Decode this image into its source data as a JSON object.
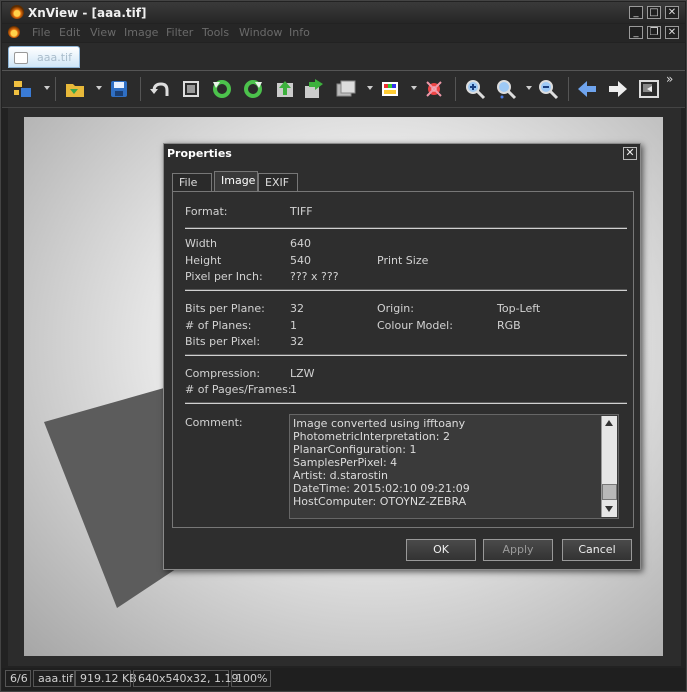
{
  "window": {
    "title": "XnView - [aaa.tif]",
    "buttons": {
      "minimize": "_",
      "maximize": "□",
      "close": "✕"
    },
    "child_buttons": {
      "minimize": "_",
      "restore": "❐",
      "close": "✕"
    }
  },
  "menu": [
    "File",
    "Edit",
    "View",
    "Image",
    "Filter",
    "Tools",
    "Window",
    "Info"
  ],
  "document_tab": {
    "label": "aaa.tif"
  },
  "toolbar": {
    "overflow": "»"
  },
  "dialog": {
    "title": "Properties",
    "close": "✕",
    "tabs": [
      "File",
      "Image",
      "EXIF"
    ],
    "active_tab": "Image",
    "format": {
      "label": "Format:",
      "value": "TIFF"
    },
    "width": {
      "label": "Width",
      "value": "640"
    },
    "height": {
      "label": "Height",
      "value": "540"
    },
    "print_size": "Print Size",
    "ppi": {
      "label": "Pixel per Inch:",
      "value": "??? x ???"
    },
    "bits_per_plane": {
      "label": "Bits per Plane:",
      "value": "32"
    },
    "planes": {
      "label": "# of Planes:",
      "value": "1"
    },
    "bits_per_pixel": {
      "label": "Bits per Pixel:",
      "value": "32"
    },
    "origin": {
      "label": "Origin:",
      "value": "Top-Left"
    },
    "colour_model": {
      "label": "Colour Model:",
      "value": "RGB"
    },
    "compression": {
      "label": "Compression:",
      "value": "LZW"
    },
    "pages": {
      "label": "# of Pages/Frames:",
      "value": "1"
    },
    "comment": {
      "label": "Comment:",
      "lines": [
        "Image converted using ifftoany",
        "PhotometricInterpretation: 2",
        "PlanarConfiguration: 1",
        "SamplesPerPixel: 4",
        "Artist: d.starostin",
        "DateTime: 2015:02:10 09:21:09",
        "HostComputer: OTOYNZ-ZEBRA"
      ]
    },
    "buttons": {
      "ok": "OK",
      "apply": "Apply",
      "cancel": "Cancel"
    }
  },
  "status": {
    "index": "6/6",
    "filename": "aaa.tif",
    "filesize": "919.12 KB",
    "info": "640x540x32, 1.19",
    "zoom": "100%"
  }
}
